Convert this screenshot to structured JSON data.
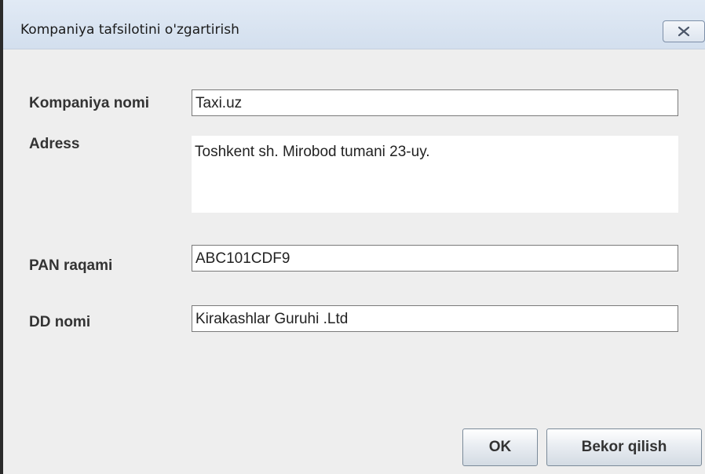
{
  "window": {
    "title": "Kompaniya tafsilotini o'zgartirish"
  },
  "form": {
    "company_name_label": "Kompaniya nomi",
    "company_name_value": "Taxi.uz",
    "address_label": "Adress",
    "address_value": "Toshkent sh. Mirobod tumani 23-uy.",
    "pan_label": "PAN raqami",
    "pan_value": "ABC101CDF9",
    "dd_label": "DD nomi",
    "dd_value": "Kirakashlar Guruhi .Ltd"
  },
  "buttons": {
    "ok_label": "OK",
    "cancel_label": "Bekor qilish"
  },
  "icons": {
    "close": "close-icon"
  }
}
